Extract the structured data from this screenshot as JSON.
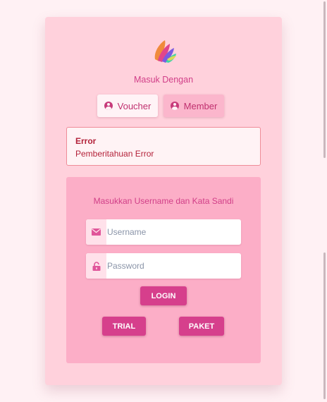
{
  "header": {
    "title": "Masuk Dengan"
  },
  "login_types": [
    {
      "label": "Voucher",
      "icon": "user-circle-icon"
    },
    {
      "label": "Member",
      "icon": "user-circle-icon"
    }
  ],
  "alert": {
    "title": "Error",
    "message": "Pemberitahuan Error"
  },
  "form": {
    "heading": "Masukkan Username dan Kata Sandi",
    "username_placeholder": "Username",
    "username_icon": "envelope-icon",
    "password_placeholder": "Password",
    "password_icon": "lock-icon",
    "login_label": "LOGIN",
    "trial_label": "TRIAL",
    "paket_label": "PAKET"
  },
  "colors": {
    "background": "#fff1f4",
    "card": "#ffd1dc",
    "panel": "#fcaec7",
    "accent": "#d63f8c",
    "error": "#b3223a"
  }
}
